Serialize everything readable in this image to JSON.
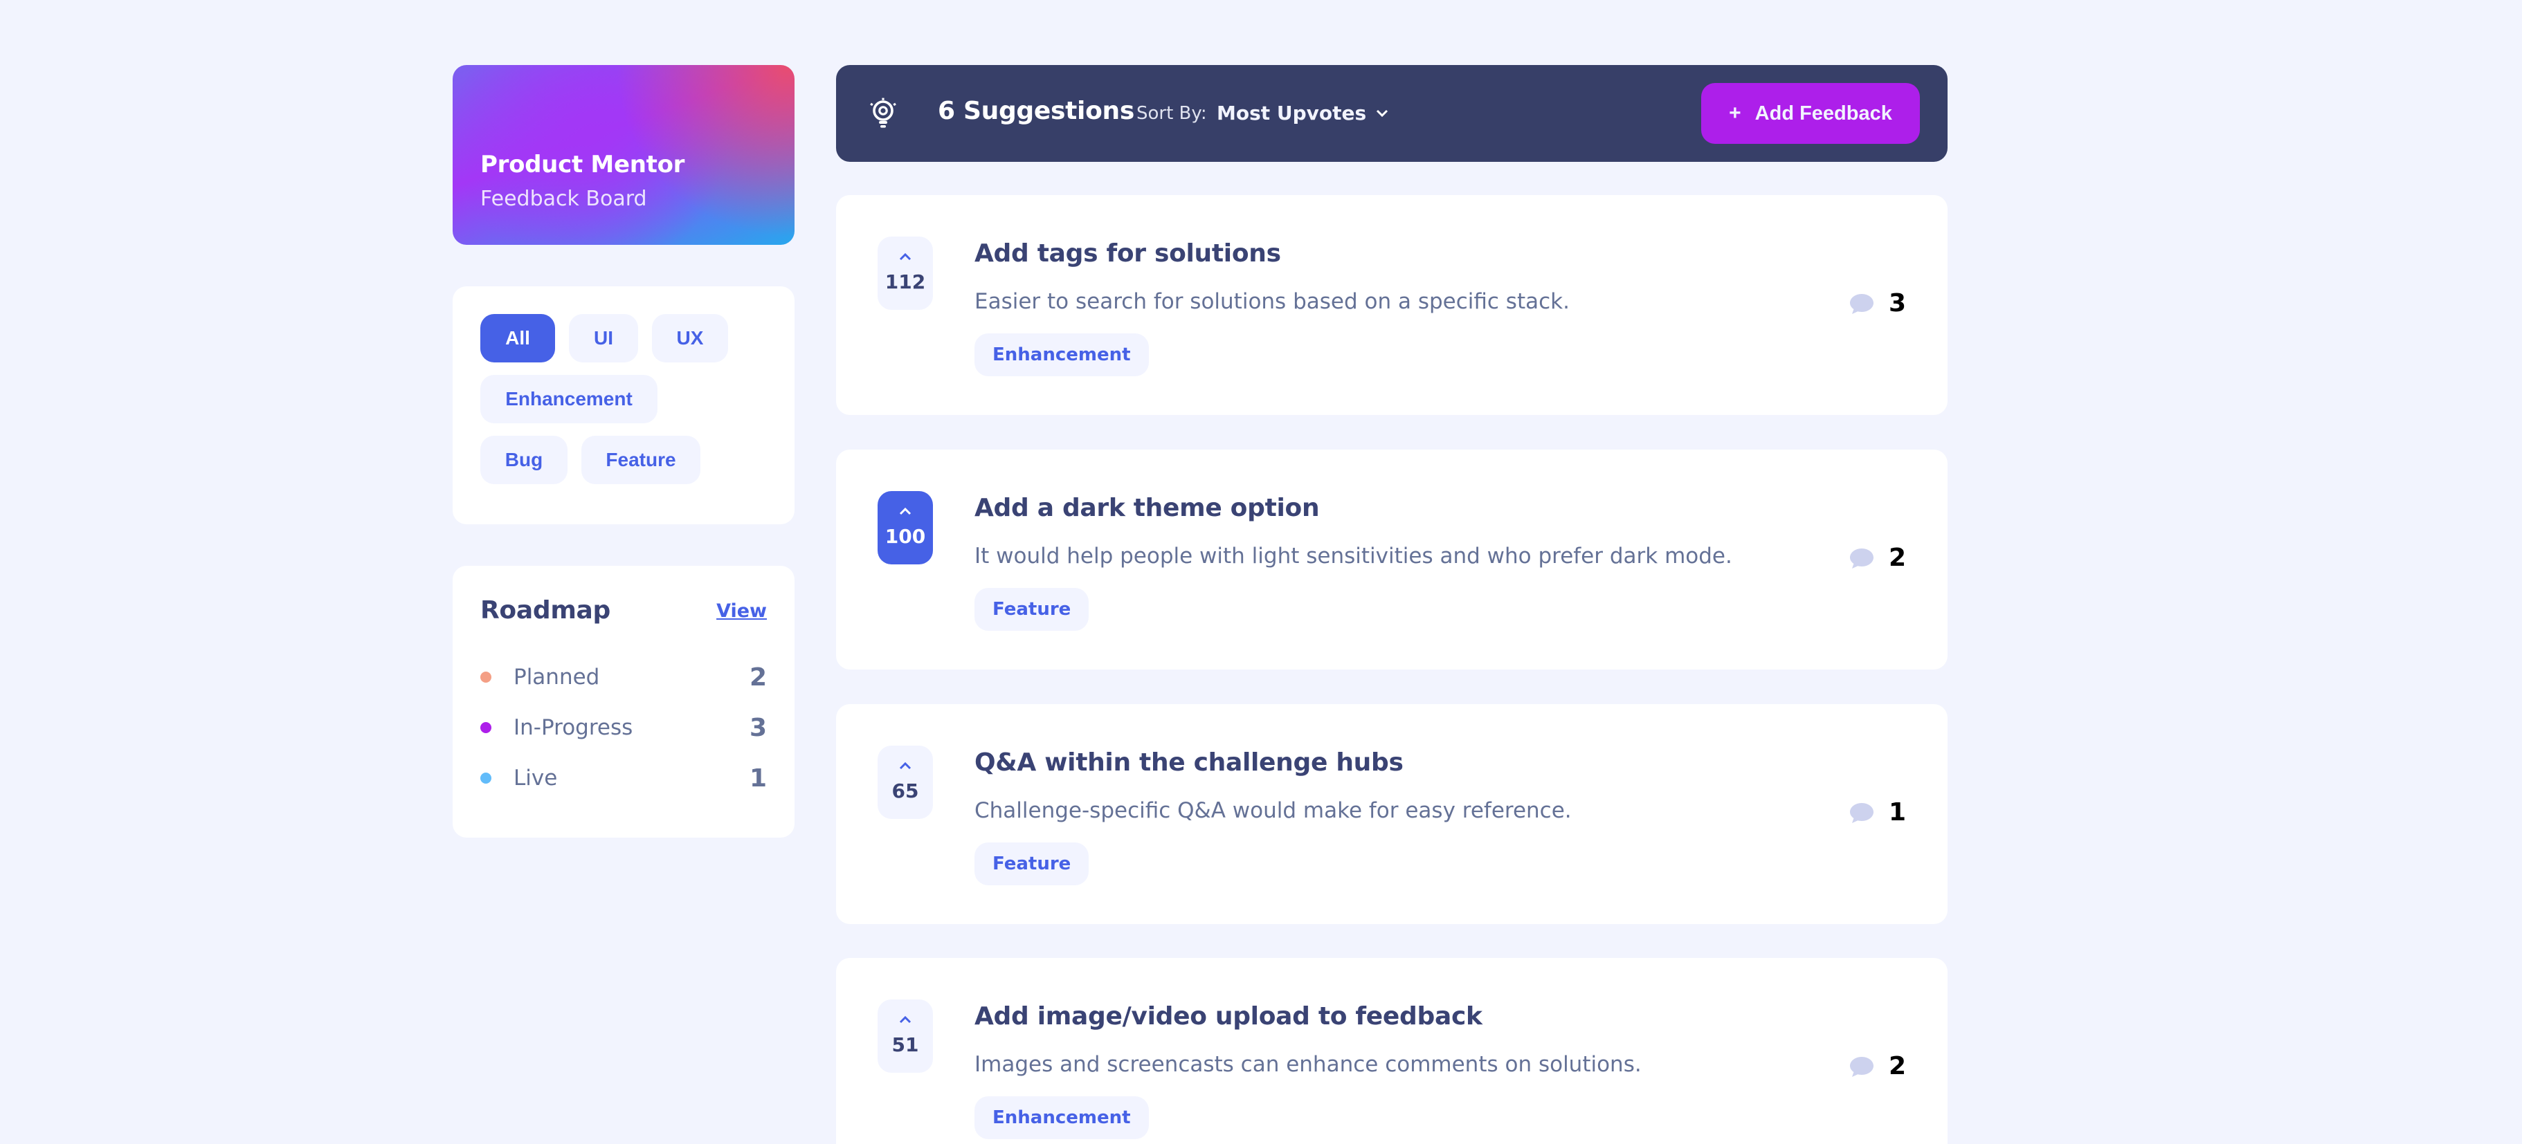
{
  "brand": {
    "title": "Product Mentor",
    "subtitle": "Feedback Board"
  },
  "filters": [
    "All",
    "UI",
    "UX",
    "Enhancement",
    "Bug",
    "Feature"
  ],
  "active_filter": "All",
  "roadmap": {
    "title": "Roadmap",
    "view_label": "View",
    "items": [
      {
        "label": "Planned",
        "count": "2",
        "color": "#F49F85"
      },
      {
        "label": "In-Progress",
        "count": "3",
        "color": "#AD1FEA"
      },
      {
        "label": "Live",
        "count": "1",
        "color": "#62BCFA"
      }
    ]
  },
  "header": {
    "icon": "lightbulb-icon",
    "suggestions_label": "6 Suggestions",
    "sort_by_label": "Sort By:",
    "sort_value": "Most Upvotes",
    "add_button_label": "Add Feedback"
  },
  "suggestions": [
    {
      "upvotes": "112",
      "title": "Add tags for solutions",
      "description": "Easier to search for solutions based on a specific stack.",
      "tag": "Enhancement",
      "comments": "3",
      "upvoted": false
    },
    {
      "upvotes": "100",
      "title": "Add a dark theme option",
      "description": "It would help people with light sensitivities and who prefer dark mode.",
      "tag": "Feature",
      "comments": "2",
      "upvoted": true
    },
    {
      "upvotes": "65",
      "title": "Q&A within the challenge hubs",
      "description": "Challenge-specific Q&A would make for easy reference.",
      "tag": "Feature",
      "comments": "1",
      "upvoted": false
    },
    {
      "upvotes": "51",
      "title": "Add image/video upload to feedback",
      "description": "Images and screencasts can enhance comments on solutions.",
      "tag": "Enhancement",
      "comments": "2",
      "upvoted": false
    }
  ],
  "colors": {
    "background": "#F2F4FE",
    "header": "#373F68",
    "accent_purple": "#AD1FEA",
    "accent_blue": "#4661E6",
    "text_dark": "#3A4374",
    "text_muted": "#647196"
  }
}
